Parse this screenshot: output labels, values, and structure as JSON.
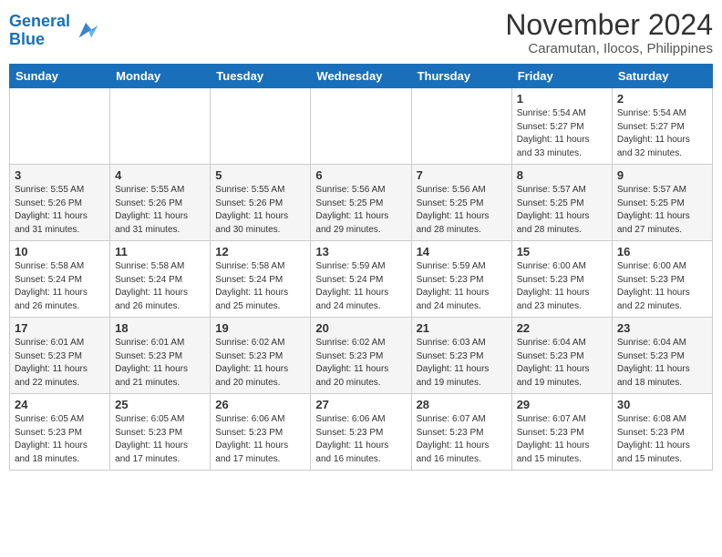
{
  "header": {
    "logo_line1": "General",
    "logo_line2": "Blue",
    "title": "November 2024",
    "subtitle": "Caramutan, Ilocos, Philippines"
  },
  "weekdays": [
    "Sunday",
    "Monday",
    "Tuesday",
    "Wednesday",
    "Thursday",
    "Friday",
    "Saturday"
  ],
  "weeks": [
    [
      {
        "day": "",
        "info": ""
      },
      {
        "day": "",
        "info": ""
      },
      {
        "day": "",
        "info": ""
      },
      {
        "day": "",
        "info": ""
      },
      {
        "day": "",
        "info": ""
      },
      {
        "day": "1",
        "info": "Sunrise: 5:54 AM\nSunset: 5:27 PM\nDaylight: 11 hours\nand 33 minutes."
      },
      {
        "day": "2",
        "info": "Sunrise: 5:54 AM\nSunset: 5:27 PM\nDaylight: 11 hours\nand 32 minutes."
      }
    ],
    [
      {
        "day": "3",
        "info": "Sunrise: 5:55 AM\nSunset: 5:26 PM\nDaylight: 11 hours\nand 31 minutes."
      },
      {
        "day": "4",
        "info": "Sunrise: 5:55 AM\nSunset: 5:26 PM\nDaylight: 11 hours\nand 31 minutes."
      },
      {
        "day": "5",
        "info": "Sunrise: 5:55 AM\nSunset: 5:26 PM\nDaylight: 11 hours\nand 30 minutes."
      },
      {
        "day": "6",
        "info": "Sunrise: 5:56 AM\nSunset: 5:25 PM\nDaylight: 11 hours\nand 29 minutes."
      },
      {
        "day": "7",
        "info": "Sunrise: 5:56 AM\nSunset: 5:25 PM\nDaylight: 11 hours\nand 28 minutes."
      },
      {
        "day": "8",
        "info": "Sunrise: 5:57 AM\nSunset: 5:25 PM\nDaylight: 11 hours\nand 28 minutes."
      },
      {
        "day": "9",
        "info": "Sunrise: 5:57 AM\nSunset: 5:25 PM\nDaylight: 11 hours\nand 27 minutes."
      }
    ],
    [
      {
        "day": "10",
        "info": "Sunrise: 5:58 AM\nSunset: 5:24 PM\nDaylight: 11 hours\nand 26 minutes."
      },
      {
        "day": "11",
        "info": "Sunrise: 5:58 AM\nSunset: 5:24 PM\nDaylight: 11 hours\nand 26 minutes."
      },
      {
        "day": "12",
        "info": "Sunrise: 5:58 AM\nSunset: 5:24 PM\nDaylight: 11 hours\nand 25 minutes."
      },
      {
        "day": "13",
        "info": "Sunrise: 5:59 AM\nSunset: 5:24 PM\nDaylight: 11 hours\nand 24 minutes."
      },
      {
        "day": "14",
        "info": "Sunrise: 5:59 AM\nSunset: 5:23 PM\nDaylight: 11 hours\nand 24 minutes."
      },
      {
        "day": "15",
        "info": "Sunrise: 6:00 AM\nSunset: 5:23 PM\nDaylight: 11 hours\nand 23 minutes."
      },
      {
        "day": "16",
        "info": "Sunrise: 6:00 AM\nSunset: 5:23 PM\nDaylight: 11 hours\nand 22 minutes."
      }
    ],
    [
      {
        "day": "17",
        "info": "Sunrise: 6:01 AM\nSunset: 5:23 PM\nDaylight: 11 hours\nand 22 minutes."
      },
      {
        "day": "18",
        "info": "Sunrise: 6:01 AM\nSunset: 5:23 PM\nDaylight: 11 hours\nand 21 minutes."
      },
      {
        "day": "19",
        "info": "Sunrise: 6:02 AM\nSunset: 5:23 PM\nDaylight: 11 hours\nand 20 minutes."
      },
      {
        "day": "20",
        "info": "Sunrise: 6:02 AM\nSunset: 5:23 PM\nDaylight: 11 hours\nand 20 minutes."
      },
      {
        "day": "21",
        "info": "Sunrise: 6:03 AM\nSunset: 5:23 PM\nDaylight: 11 hours\nand 19 minutes."
      },
      {
        "day": "22",
        "info": "Sunrise: 6:04 AM\nSunset: 5:23 PM\nDaylight: 11 hours\nand 19 minutes."
      },
      {
        "day": "23",
        "info": "Sunrise: 6:04 AM\nSunset: 5:23 PM\nDaylight: 11 hours\nand 18 minutes."
      }
    ],
    [
      {
        "day": "24",
        "info": "Sunrise: 6:05 AM\nSunset: 5:23 PM\nDaylight: 11 hours\nand 18 minutes."
      },
      {
        "day": "25",
        "info": "Sunrise: 6:05 AM\nSunset: 5:23 PM\nDaylight: 11 hours\nand 17 minutes."
      },
      {
        "day": "26",
        "info": "Sunrise: 6:06 AM\nSunset: 5:23 PM\nDaylight: 11 hours\nand 17 minutes."
      },
      {
        "day": "27",
        "info": "Sunrise: 6:06 AM\nSunset: 5:23 PM\nDaylight: 11 hours\nand 16 minutes."
      },
      {
        "day": "28",
        "info": "Sunrise: 6:07 AM\nSunset: 5:23 PM\nDaylight: 11 hours\nand 16 minutes."
      },
      {
        "day": "29",
        "info": "Sunrise: 6:07 AM\nSunset: 5:23 PM\nDaylight: 11 hours\nand 15 minutes."
      },
      {
        "day": "30",
        "info": "Sunrise: 6:08 AM\nSunset: 5:23 PM\nDaylight: 11 hours\nand 15 minutes."
      }
    ]
  ]
}
